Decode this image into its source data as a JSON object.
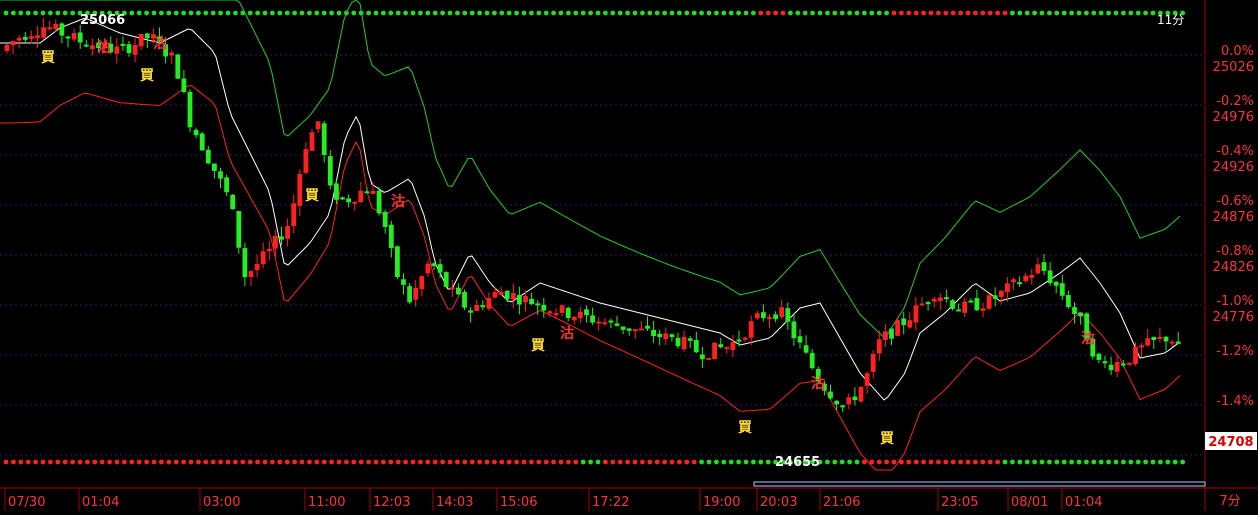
{
  "chart_data": {
    "type": "candlestick",
    "interval_label": "7分",
    "price_label_top": "25066",
    "price_label_low": "24655",
    "current_price": "24708",
    "top_right_label": "11分",
    "y_axis": {
      "labels": [
        {
          "pct": "0.0%",
          "price": "25026"
        },
        {
          "pct": "-0.2%",
          "price": "24976"
        },
        {
          "pct": "-0.4%",
          "price": "24926"
        },
        {
          "pct": "-0.6%",
          "price": "24876"
        },
        {
          "pct": "-0.8%",
          "price": "24826"
        },
        {
          "pct": "-1.0%",
          "price": "24776"
        },
        {
          "pct": "-1.2%",
          "price": ""
        },
        {
          "pct": "-1.4%",
          "price": ""
        }
      ],
      "range": [
        24640,
        25100
      ]
    },
    "x_axis": {
      "tick_labels": [
        "07/30",
        "01:04",
        "03:00",
        "11:00",
        "12:03",
        "14:03",
        "15:06",
        "17:22",
        "19:00",
        "20:03",
        "21:06",
        "23:05",
        "08/01",
        "01:04"
      ]
    },
    "signals": {
      "buy_label": "買",
      "sell_label": "沽"
    },
    "colors": {
      "up": "#ff2020",
      "down": "#22ee22",
      "ma": "#ffffff",
      "band_upper": "#22cc22",
      "band_lower": "#ff2020",
      "background": "#000000",
      "axis": "#aa0000",
      "label_pct": "#ff3333",
      "buy_text": "#ffdd33",
      "sell_text": "#ff3333"
    }
  }
}
